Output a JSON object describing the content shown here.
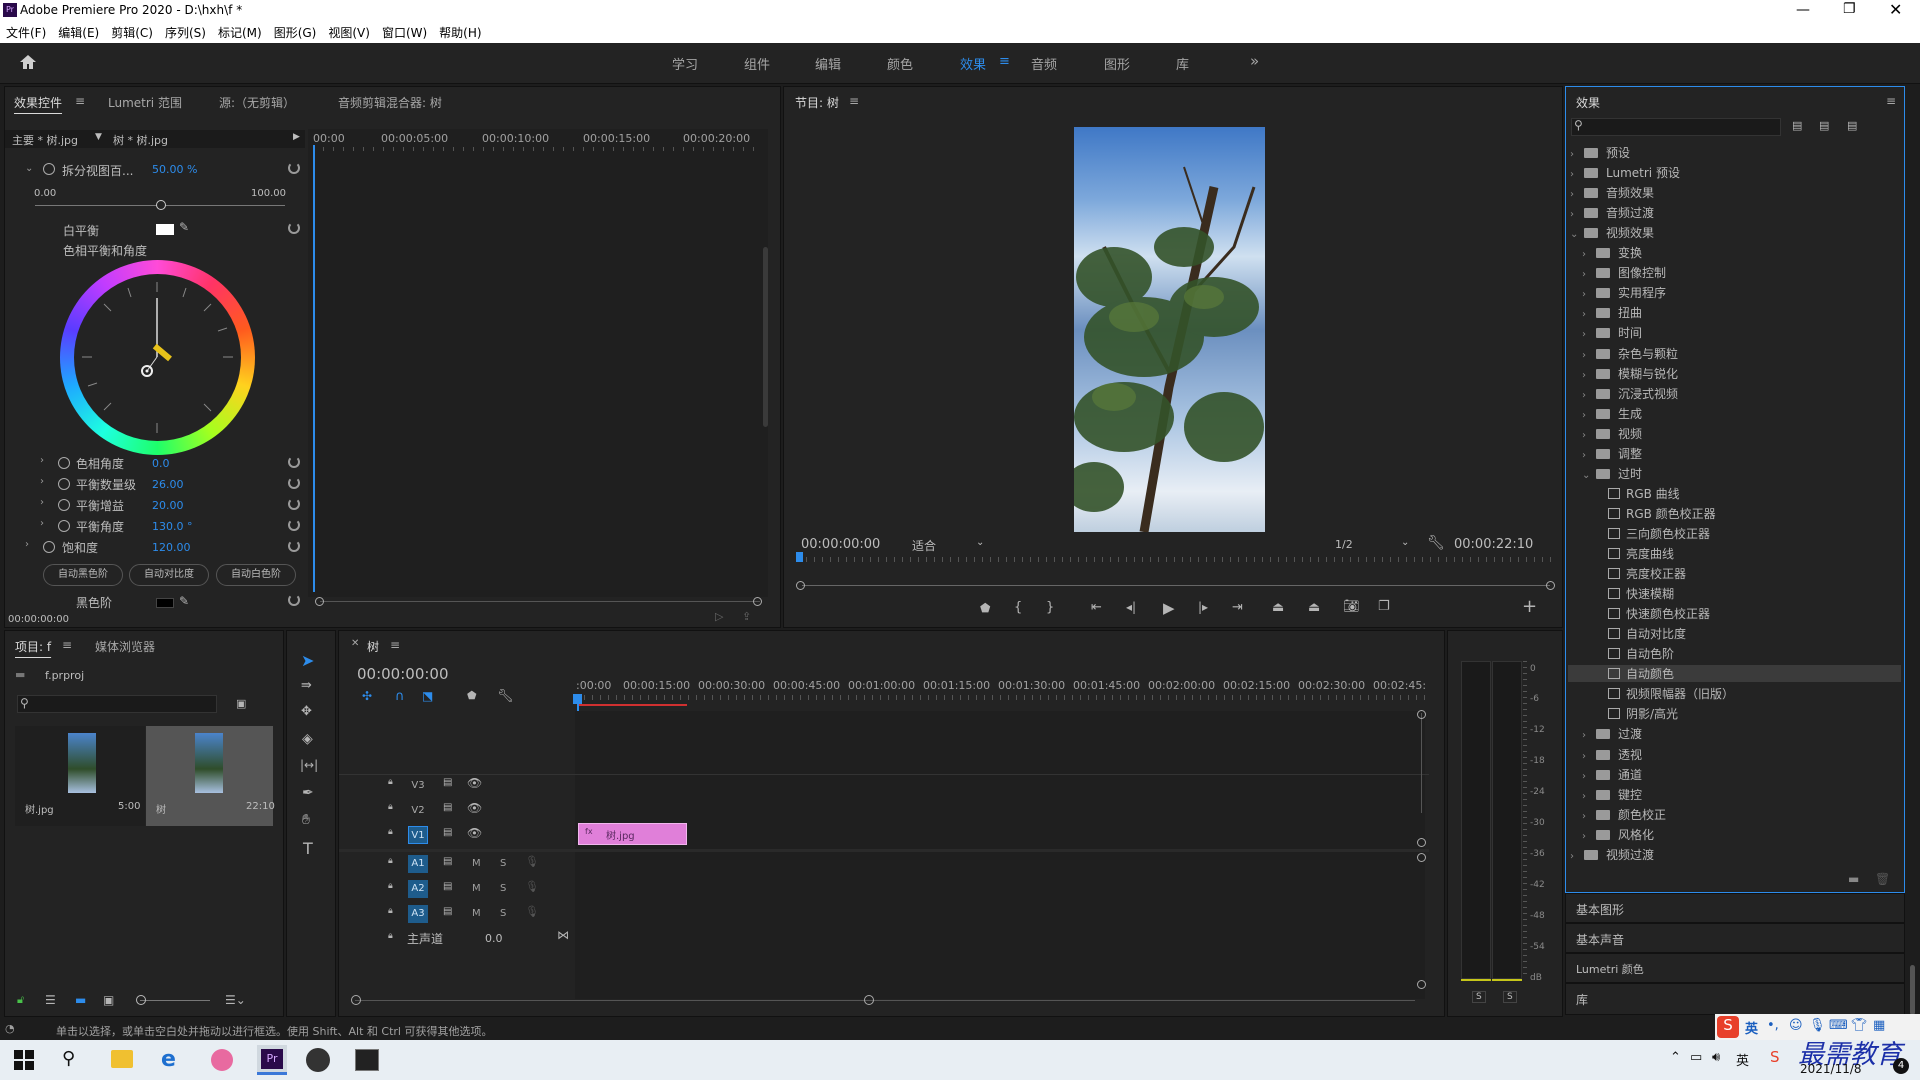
{
  "window": {
    "title": "Adobe Premiere Pro 2020 - D:\\hxh\\f *",
    "logo": "Pr",
    "controls": [
      "minimize-icon",
      "maximize-icon",
      "close-icon"
    ]
  },
  "menu": [
    "文件(F)",
    "编辑(E)",
    "剪辑(C)",
    "序列(S)",
    "标记(M)",
    "图形(G)",
    "视图(V)",
    "窗口(W)",
    "帮助(H)"
  ],
  "workspaces": {
    "items": [
      "学习",
      "组件",
      "编辑",
      "颜色",
      "效果",
      "音频",
      "图形",
      "库"
    ],
    "active": "效果",
    "more": "»"
  },
  "effect_controls": {
    "tabs": [
      "效果控件",
      "Lumetri 范围",
      "源:（无剪辑）",
      "音频剪辑混合器: 树"
    ],
    "master": "主要 * 树.jpg",
    "clip": "树 * 树.jpg",
    "ruler": [
      "00:00",
      "00:00:05:00",
      "00:00:10:00",
      "00:00:15:00",
      "00:00:20:00"
    ],
    "split_label": "拆分视图百...",
    "split_value": "50.00 %",
    "slider_min": "0.00",
    "slider_max": "100.00",
    "white_balance": "白平衡",
    "hue_balance": "色相平衡和角度",
    "hue_angle": {
      "label": "色相角度",
      "value": "0.0"
    },
    "balance_mag": {
      "label": "平衡数量级",
      "value": "26.00"
    },
    "balance_gain": {
      "label": "平衡增益",
      "value": "20.00"
    },
    "balance_angle": {
      "label": "平衡角度",
      "value": "130.0 °"
    },
    "saturation": {
      "label": "饱和度",
      "value": "120.00"
    },
    "buttons": [
      "自动黑色阶",
      "自动对比度",
      "自动白色阶"
    ],
    "black_level": "黑色阶",
    "timecode": "00:00:00:00"
  },
  "program_monitor": {
    "title": "节目: 树",
    "timecode": "00:00:00:00",
    "fit": "适合",
    "resolution": "1/2",
    "duration": "00:00:22:10"
  },
  "effects_panel": {
    "title": "效果",
    "search_placeholder": "",
    "tree": [
      {
        "label": "预设",
        "level": 0,
        "kind": "folder",
        "open": false
      },
      {
        "label": "Lumetri 预设",
        "level": 0,
        "kind": "folder",
        "open": false
      },
      {
        "label": "音频效果",
        "level": 0,
        "kind": "folder",
        "open": false
      },
      {
        "label": "音频过渡",
        "level": 0,
        "kind": "folder",
        "open": false
      },
      {
        "label": "视频效果",
        "level": 0,
        "kind": "folder",
        "open": true
      },
      {
        "label": "变换",
        "level": 1,
        "kind": "folder",
        "open": false
      },
      {
        "label": "图像控制",
        "level": 1,
        "kind": "folder",
        "open": false
      },
      {
        "label": "实用程序",
        "level": 1,
        "kind": "folder",
        "open": false
      },
      {
        "label": "扭曲",
        "level": 1,
        "kind": "folder",
        "open": false
      },
      {
        "label": "时间",
        "level": 1,
        "kind": "folder",
        "open": false
      },
      {
        "label": "杂色与颗粒",
        "level": 1,
        "kind": "folder",
        "open": false
      },
      {
        "label": "模糊与锐化",
        "level": 1,
        "kind": "folder",
        "open": false
      },
      {
        "label": "沉浸式视频",
        "level": 1,
        "kind": "folder",
        "open": false
      },
      {
        "label": "生成",
        "level": 1,
        "kind": "folder",
        "open": false
      },
      {
        "label": "视频",
        "level": 1,
        "kind": "folder",
        "open": false
      },
      {
        "label": "调整",
        "level": 1,
        "kind": "folder",
        "open": false
      },
      {
        "label": "过时",
        "level": 1,
        "kind": "folder",
        "open": true
      },
      {
        "label": "RGB 曲线",
        "level": 2,
        "kind": "fx"
      },
      {
        "label": "RGB 颜色校正器",
        "level": 2,
        "kind": "fx"
      },
      {
        "label": "三向颜色校正器",
        "level": 2,
        "kind": "fx"
      },
      {
        "label": "亮度曲线",
        "level": 2,
        "kind": "fx"
      },
      {
        "label": "亮度校正器",
        "level": 2,
        "kind": "fx"
      },
      {
        "label": "快速模糊",
        "level": 2,
        "kind": "fx"
      },
      {
        "label": "快速颜色校正器",
        "level": 2,
        "kind": "fx"
      },
      {
        "label": "自动对比度",
        "level": 2,
        "kind": "fx"
      },
      {
        "label": "自动色阶",
        "level": 2,
        "kind": "fx"
      },
      {
        "label": "自动颜色",
        "level": 2,
        "kind": "fx",
        "selected": true
      },
      {
        "label": "视频限幅器（旧版）",
        "level": 2,
        "kind": "fx"
      },
      {
        "label": "阴影/高光",
        "level": 2,
        "kind": "fx"
      },
      {
        "label": "过渡",
        "level": 1,
        "kind": "folder",
        "open": false
      },
      {
        "label": "透视",
        "level": 1,
        "kind": "folder",
        "open": false
      },
      {
        "label": "通道",
        "level": 1,
        "kind": "folder",
        "open": false
      },
      {
        "label": "键控",
        "level": 1,
        "kind": "folder",
        "open": false
      },
      {
        "label": "颜色校正",
        "level": 1,
        "kind": "folder",
        "open": false
      },
      {
        "label": "风格化",
        "level": 1,
        "kind": "folder",
        "open": false
      },
      {
        "label": "视频过渡",
        "level": 0,
        "kind": "folder",
        "open": false
      }
    ],
    "collapsed_panels": [
      "基本图形",
      "基本声音",
      "Lumetri 颜色",
      "库"
    ]
  },
  "project": {
    "tabs": [
      "项目: f",
      "媒体浏览器"
    ],
    "file": "f.prproj",
    "items": [
      {
        "name": "树.jpg",
        "duration": "5:00"
      },
      {
        "name": "树",
        "duration": "22:10"
      }
    ]
  },
  "timeline": {
    "tab": "树",
    "timecode": "00:00:00:00",
    "ruler": [
      ":00:00",
      "00:00:15:00",
      "00:00:30:00",
      "00:00:45:00",
      "00:01:00:00",
      "00:01:15:00",
      "00:01:30:00",
      "00:01:45:00",
      "00:02:00:00",
      "00:02:15:00",
      "00:02:30:00",
      "00:02:45:"
    ],
    "video_tracks": [
      "V3",
      "V2",
      "V1"
    ],
    "audio_tracks": [
      "A1",
      "A2",
      "A3"
    ],
    "master": {
      "label": "主声道",
      "value": "0.0"
    },
    "clip": "树.jpg"
  },
  "audio_meter": {
    "scale": [
      "0",
      "-6",
      "-12",
      "-18",
      "-24",
      "-30",
      "-36",
      "-42",
      "-48",
      "-54",
      "dB"
    ],
    "solo": [
      "S",
      "S"
    ]
  },
  "status": "单击以选择，或单击空白处并拖动以进行框选。使用 Shift、Alt 和 Ctrl 可获得其他选项。",
  "taskbar": {
    "brand": "最需教育",
    "date": "2021/11/8",
    "ime": "英",
    "badge": "4"
  },
  "colors": {
    "accent": "#2d8ceb",
    "clip": "#e07fd9",
    "panel": "#232323"
  }
}
